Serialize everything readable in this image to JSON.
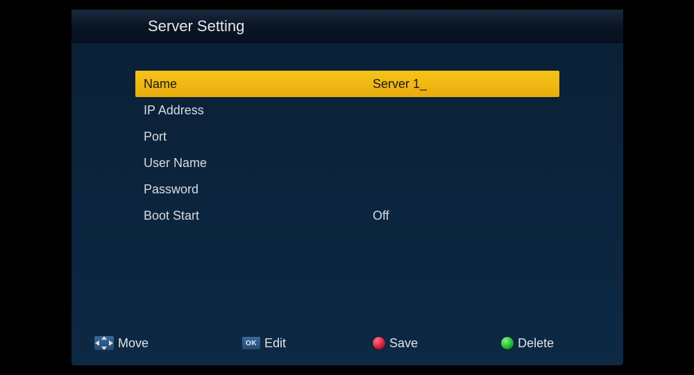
{
  "header": {
    "title": "Server Setting"
  },
  "rows": [
    {
      "label": "Name",
      "value": "Server 1_",
      "selected": true
    },
    {
      "label": "IP Address",
      "value": "",
      "selected": false
    },
    {
      "label": "Port",
      "value": "",
      "selected": false
    },
    {
      "label": "User Name",
      "value": "",
      "selected": false
    },
    {
      "label": "Password",
      "value": "",
      "selected": false
    },
    {
      "label": "Boot Start",
      "value": "Off",
      "selected": false
    }
  ],
  "footer": {
    "move": "Move",
    "edit": "Edit",
    "ok_badge": "OK",
    "save": "Save",
    "delete": "Delete"
  }
}
